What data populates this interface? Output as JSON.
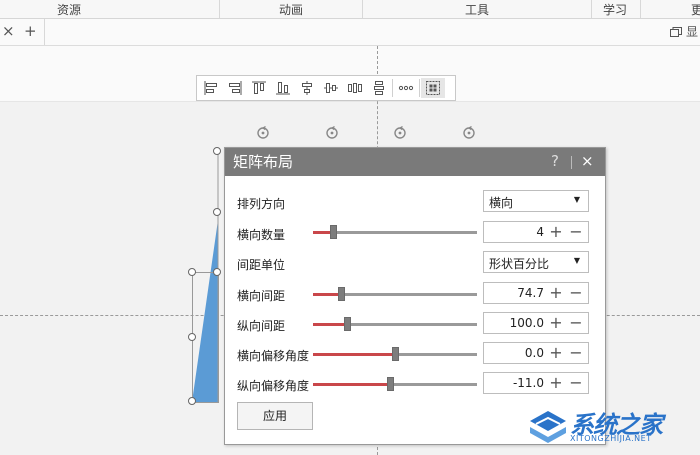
{
  "ribbon": {
    "groups": [
      "资源",
      "动画",
      "工具",
      "学习",
      "更"
    ]
  },
  "tabbar": {
    "close_glyph": "×",
    "add_glyph": "+",
    "right_text": "显"
  },
  "dialog": {
    "title": "矩阵布局",
    "help": "?",
    "close": "×",
    "rows": [
      {
        "label": "排列方向",
        "type": "select",
        "value": "横向"
      },
      {
        "label": "横向数量",
        "type": "slider",
        "value": "4",
        "fill": 0.12
      },
      {
        "label": "间距单位",
        "type": "select",
        "value": "形状百分比"
      },
      {
        "label": "横向间距",
        "type": "slider",
        "value": "74.7",
        "fill": 0.17
      },
      {
        "label": "纵向间距",
        "type": "slider",
        "value": "100.0",
        "fill": 0.21
      },
      {
        "label": "横向偏移角度",
        "type": "slider",
        "value": "0.0",
        "fill": 0.5
      },
      {
        "label": "纵向偏移角度",
        "type": "slider",
        "value": "-11.0",
        "fill": 0.47
      }
    ],
    "plus": "+",
    "minus": "−",
    "caret": "▼",
    "apply": "应用"
  },
  "watermark": {
    "brand": "系统之家",
    "sub": "XITONGZHIJIA.NET"
  },
  "colors": {
    "accent": "#c9474a",
    "shape_blue": "#5b9bd5",
    "dialog_header": "#7a7a7a"
  }
}
